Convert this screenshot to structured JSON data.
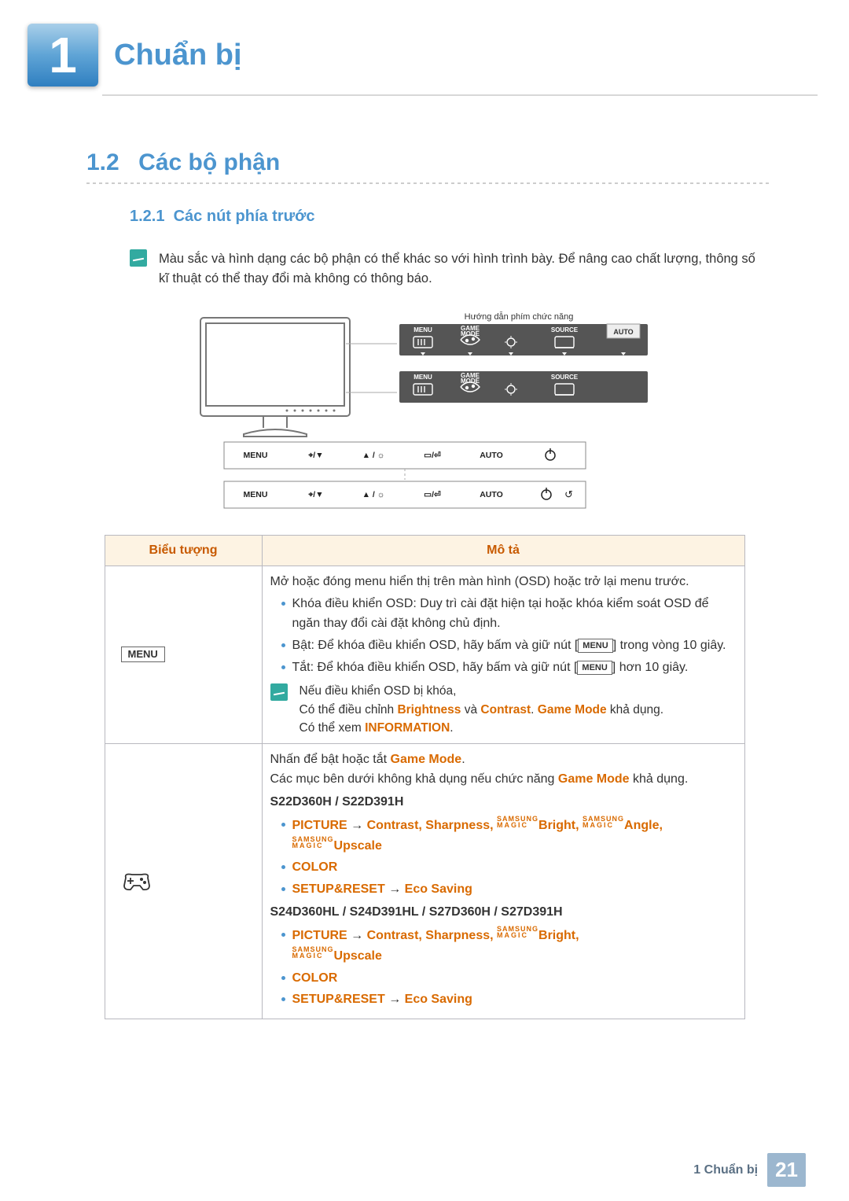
{
  "header": {
    "chapter_number": "1",
    "chapter_title": "Chuẩn bị"
  },
  "section": {
    "number": "1.2",
    "title": "Các bộ phận"
  },
  "subsection": {
    "number": "1.2.1",
    "title": "Các nút phía trước"
  },
  "note_top": "Màu sắc và hình dạng các bộ phận có thể khác so với hình trình bày. Để nâng cao chất lượng, thông số kĩ thuật có thể thay đổi mà không có thông báo.",
  "diagram": {
    "caption": "Hướng dẫn phím chức năng",
    "row_labels": [
      "MENU",
      "GAME MODE",
      "",
      "SOURCE",
      "AUTO"
    ],
    "bottom_labels": [
      "MENU",
      "⌖/▼",
      "▲/☼",
      "▭/⏎",
      "AUTO",
      "⏻"
    ],
    "bottom_labels2": [
      "MENU",
      "⌖/▼",
      "▲/☼",
      "▭/⏎",
      "AUTO",
      "⏻ ↺"
    ]
  },
  "table": {
    "headers": [
      "Biểu tượng",
      "Mô tả"
    ],
    "rows": [
      {
        "icon_label": "MENU",
        "desc": {
          "intro": "Mở hoặc đóng menu hiển thị trên màn hình (OSD) hoặc trở lại menu trước.",
          "bullets": [
            {
              "lead": "Khóa điều khiển OSD: Duy trì cài đặt hiện tại hoặc khóa kiểm soát OSD để ngăn thay đổi cài đặt không chủ định."
            },
            {
              "prefix": "Bật: Để khóa điều khiển OSD, hãy bấm và giữ nút [",
              "key": "MENU",
              "suffix": "] trong vòng 10 giây."
            },
            {
              "prefix": "Tắt: Để khóa điều khiển OSD, hãy bấm và giữ nút [",
              "key": "MENU",
              "suffix": "] hơn 10 giây."
            }
          ],
          "nested_note": {
            "line1": "Nếu điều khiển OSD bị khóa,",
            "line2_a": "Có thể điều chỉnh ",
            "bright": "Brightness",
            "and": " và ",
            "contrast": "Contrast",
            "sep": ". ",
            "gamemode": "Game Mode",
            "line2_b": " khả dụng.",
            "line3_a": "Có thể xem ",
            "info": "INFORMATION",
            "line3_b": "."
          }
        }
      },
      {
        "icon_label": "gamepad",
        "desc": {
          "line1_a": "Nhấn để bật hoặc tắt ",
          "gm": "Game Mode",
          "line1_b": ".",
          "line2_a": "Các mục bên dưới không khả dụng nếu chức năng ",
          "gm2": "Game Mode",
          "line2_b": " khả dụng.",
          "models1": "S22D360H / S22D391H",
          "set1": [
            {
              "type": "picture",
              "prefix": "PICTURE",
              "arrow": "  →  ",
              "items": "Contrast, Sharpness, ",
              "sm1": "Bright",
              "comma": ", ",
              "sm2": "Angle",
              "comma2": ", ",
              "upscale": "Upscale"
            },
            {
              "type": "simple",
              "text": "COLOR"
            },
            {
              "type": "setup",
              "prefix": "SETUP&RESET",
              "arrow": "  →  ",
              "item": "Eco Saving"
            }
          ],
          "models2": "S24D360HL / S24D391HL / S27D360H / S27D391H",
          "set2": [
            {
              "type": "picture2",
              "prefix": "PICTURE",
              "arrow": "  →  ",
              "items": "Contrast, Sharpness, ",
              "sm1": "Bright",
              "comma": ", ",
              "upscale": "Upscale"
            },
            {
              "type": "simple",
              "text": "COLOR"
            },
            {
              "type": "setup",
              "prefix": "SETUP&RESET",
              "arrow": "  →  ",
              "item": "Eco Saving"
            }
          ]
        }
      }
    ]
  },
  "footer": {
    "text": "1 Chuẩn bị",
    "page": "21"
  }
}
